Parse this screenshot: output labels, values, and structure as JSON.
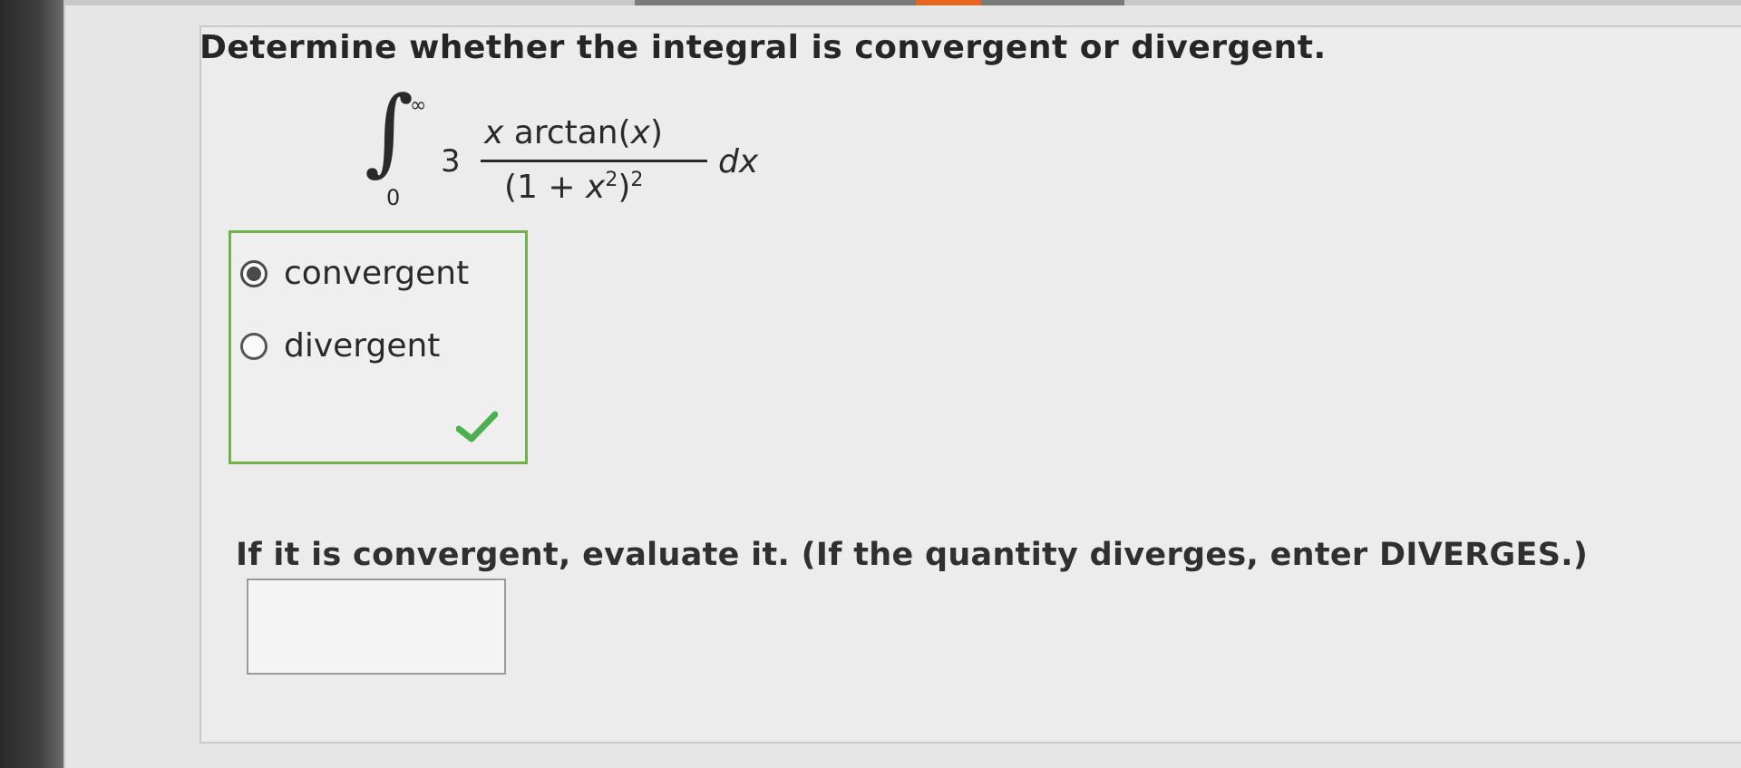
{
  "question": {
    "prompt": "Determine whether the integral is convergent or divergent."
  },
  "integral": {
    "sign": "∫",
    "upper_limit": "∞",
    "lower_limit": "0",
    "coefficient": "3",
    "numerator_var": "x",
    "numerator_rest": " arctan(",
    "numerator_arg": "x",
    "numerator_close": ")",
    "denominator_open": "(1 + ",
    "denominator_var": "x",
    "inner_exponent": "2",
    "denominator_close": ")",
    "outer_exponent": "2",
    "differential": "dx"
  },
  "choices": {
    "options": [
      {
        "label": "convergent",
        "selected": true
      },
      {
        "label": "divergent",
        "selected": false
      }
    ],
    "feedback_icon": "checkmark-icon",
    "feedback_color": "#4caf50"
  },
  "evaluate": {
    "instruction": "If it is convergent, evaluate it. (If the quantity diverges, enter DIVERGES.)",
    "answer_value": ""
  }
}
